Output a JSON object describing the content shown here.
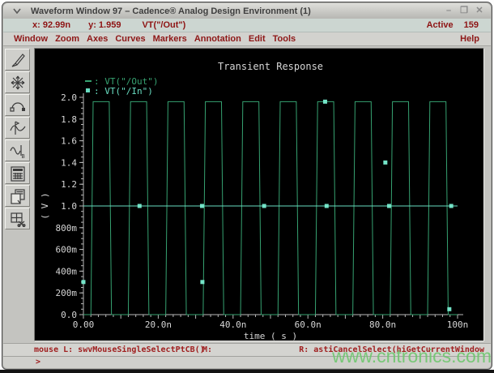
{
  "window": {
    "title": "Waveform Window 97 – Cadence® Analog Design Environment (1)",
    "buttons": {
      "minimize": "–",
      "maximize": "❒",
      "close": "✕"
    }
  },
  "coord_status": {
    "x_value": "x: 92.99n",
    "y_value": "y: 1.959",
    "trace": "VT(\"/Out\")",
    "active_label": "Active",
    "active_count": "159"
  },
  "menubar": {
    "items": [
      "Window",
      "Zoom",
      "Axes",
      "Curves",
      "Markers",
      "Annotation",
      "Edit",
      "Tools"
    ],
    "help": "Help"
  },
  "toolbar": {
    "icons": [
      "probe-pen-icon",
      "zoom-fit-icon",
      "trace-arc-icon",
      "vertical-marker-icon",
      "sine-marker-b-icon",
      "calculator-icon",
      "copy-window-icon",
      "subwindow-scissors-icon"
    ]
  },
  "chart_data": {
    "type": "line",
    "title": "Transient Response",
    "xlabel": "time ( s )",
    "ylabel": "( V )",
    "xlim": [
      0,
      100
    ],
    "ylim": [
      0,
      2.0
    ],
    "x_unit": "ns",
    "grid": false,
    "legend_position": "top-left",
    "axis_color": "#b8b8b8",
    "text_color": "#d6d6d6",
    "marker_color": "#74e4c8",
    "x_ticks": [
      {
        "v": 0,
        "label": "0.00"
      },
      {
        "v": 20,
        "label": "20.0n"
      },
      {
        "v": 40,
        "label": "40.0n"
      },
      {
        "v": 60,
        "label": "60.0n"
      },
      {
        "v": 80,
        "label": "80.0n"
      },
      {
        "v": 100,
        "label": "100n"
      }
    ],
    "x_minor_step": 2,
    "x_mid_step": 10,
    "y_ticks": [
      {
        "v": 2.0,
        "label": "2.0"
      },
      {
        "v": 1.8,
        "label": "1.8"
      },
      {
        "v": 1.6,
        "label": "1.6"
      },
      {
        "v": 1.4,
        "label": "1.4"
      },
      {
        "v": 1.2,
        "label": "1.2"
      },
      {
        "v": 1.0,
        "label": "1.0"
      },
      {
        "v": 0.8,
        "label": "800m"
      },
      {
        "v": 0.6,
        "label": "600m"
      },
      {
        "v": 0.4,
        "label": "400m"
      },
      {
        "v": 0.2,
        "label": "200m"
      },
      {
        "v": 0.0,
        "label": "0.0"
      }
    ],
    "y_minor_step": 0.05,
    "series": [
      {
        "name": "VT(\"/Out\")",
        "color": "#36a271",
        "legend_marker": "dash",
        "points": [
          [
            0,
            0
          ],
          [
            2,
            0
          ],
          [
            2.6,
            1.96
          ],
          [
            6.9,
            1.96
          ],
          [
            7.5,
            0
          ],
          [
            12,
            0
          ],
          [
            12.6,
            1.96
          ],
          [
            16.9,
            1.96
          ],
          [
            17.5,
            0
          ],
          [
            22,
            0
          ],
          [
            22.6,
            1.96
          ],
          [
            26.9,
            1.96
          ],
          [
            27.5,
            0
          ],
          [
            32,
            0
          ],
          [
            32.6,
            1.96
          ],
          [
            36.9,
            1.96
          ],
          [
            37.5,
            0
          ],
          [
            42,
            0
          ],
          [
            42.6,
            1.96
          ],
          [
            46.9,
            1.96
          ],
          [
            47.5,
            0
          ],
          [
            52,
            0
          ],
          [
            52.6,
            1.96
          ],
          [
            56.9,
            1.96
          ],
          [
            57.5,
            0
          ],
          [
            62,
            0
          ],
          [
            62.6,
            1.96
          ],
          [
            66.9,
            1.96
          ],
          [
            67.5,
            0
          ],
          [
            72,
            0
          ],
          [
            72.6,
            1.96
          ],
          [
            76.9,
            1.96
          ],
          [
            77.5,
            0
          ],
          [
            82,
            0
          ],
          [
            82.6,
            1.96
          ],
          [
            86.9,
            1.96
          ],
          [
            87.5,
            0
          ],
          [
            92,
            0
          ],
          [
            92.6,
            1.96
          ],
          [
            96.9,
            1.96
          ],
          [
            97.5,
            0
          ],
          [
            100,
            0
          ]
        ],
        "markers": [
          [
            0,
            0.3
          ],
          [
            31.8,
            0.3
          ],
          [
            64.6,
            1.96
          ],
          [
            80.7,
            1.4
          ],
          [
            97.8,
            0.05
          ]
        ]
      },
      {
        "name": "VT(\"/In\")",
        "color": "#68dcc1",
        "legend_marker": "square",
        "points": [
          [
            0,
            1.0
          ],
          [
            100,
            1.0
          ]
        ],
        "markers": [
          [
            15,
            1.0
          ],
          [
            31.7,
            1.0
          ],
          [
            48.3,
            1.0
          ],
          [
            65,
            1.0
          ],
          [
            81.7,
            1.0
          ],
          [
            98.3,
            1.0
          ]
        ]
      }
    ]
  },
  "mouse_status": {
    "left": "mouse L: swvMouseSingleSelectPtCB()",
    "middle": "M:",
    "right": "R: astiCancelSelect(hiGetCurrentWindow"
  },
  "prompt": ">",
  "watermark": "www.cntronics.com"
}
